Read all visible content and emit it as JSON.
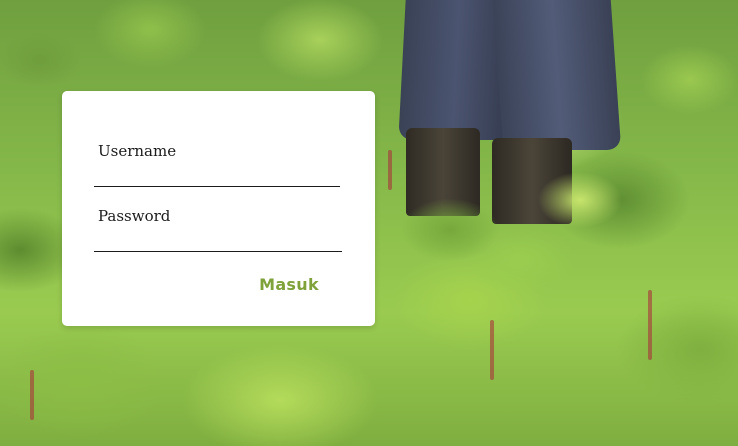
{
  "login": {
    "username_label": "Username",
    "username_value": "",
    "password_label": "Password",
    "password_value": "",
    "submit_label": "Masuk"
  },
  "colors": {
    "accent": "#7fa23a",
    "card_background": "#ffffff",
    "underline": "#1b1b1b"
  }
}
